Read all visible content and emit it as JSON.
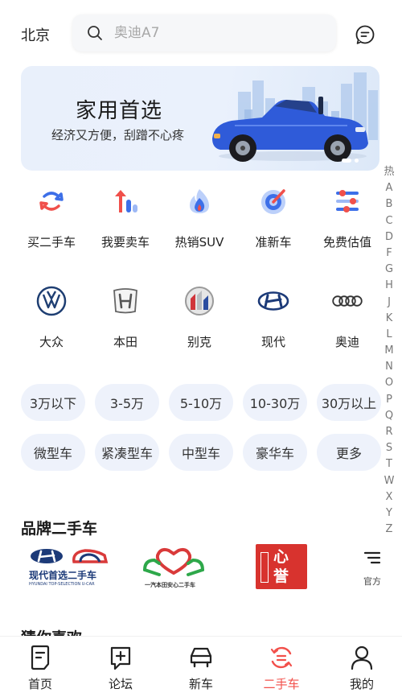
{
  "header": {
    "city": "北京",
    "search_placeholder": "奥迪A7"
  },
  "banner": {
    "title": "家用首选",
    "subtitle": "经济又方便，刮蹭不心疼"
  },
  "index_bar": [
    "热",
    "A",
    "B",
    "C",
    "D",
    "F",
    "G",
    "H",
    "J",
    "K",
    "L",
    "M",
    "N",
    "O",
    "P",
    "Q",
    "R",
    "S",
    "T",
    "W",
    "X",
    "Y",
    "Z"
  ],
  "services": [
    {
      "label": "买二手车",
      "icon": "buy-used-car-icon"
    },
    {
      "label": "我要卖车",
      "icon": "sell-car-icon"
    },
    {
      "label": "热销SUV",
      "icon": "hot-suv-icon"
    },
    {
      "label": "准新车",
      "icon": "quasi-new-car-icon"
    },
    {
      "label": "免费估值",
      "icon": "free-valuation-icon"
    }
  ],
  "brands": [
    {
      "label": "大众",
      "icon": "volkswagen-logo-icon"
    },
    {
      "label": "本田",
      "icon": "honda-logo-icon"
    },
    {
      "label": "别克",
      "icon": "buick-logo-icon"
    },
    {
      "label": "现代",
      "icon": "hyundai-logo-icon"
    },
    {
      "label": "奥迪",
      "icon": "audi-logo-icon"
    }
  ],
  "price_filters": [
    "3万以下",
    "3-5万",
    "5-10万",
    "10-30万",
    "30万以上"
  ],
  "type_filters": [
    "微型车",
    "紧凑型车",
    "中型车",
    "豪华车",
    "更多"
  ],
  "brand_section": {
    "title": "品牌二手车",
    "hyundai_name": "现代首选二手车",
    "hyundai_sub": "HYUNDAI TOP-SELECTION U-CAR",
    "honda_name": "一汽本田安心二手车",
    "xinyu_text": "心誉",
    "official": "官方"
  },
  "guess_section": {
    "title": "猜你喜欢"
  },
  "tabs": [
    {
      "label": "首页",
      "icon": "home-icon"
    },
    {
      "label": "论坛",
      "icon": "forum-icon"
    },
    {
      "label": "新车",
      "icon": "new-car-icon"
    },
    {
      "label": "二手车",
      "icon": "used-car-icon"
    },
    {
      "label": "我的",
      "icon": "profile-icon"
    }
  ],
  "colors": {
    "accent": "#f2504b",
    "pill_bg": "#eef2fb",
    "icon_blue": "#3d6fe8",
    "icon_red": "#f0504b"
  }
}
